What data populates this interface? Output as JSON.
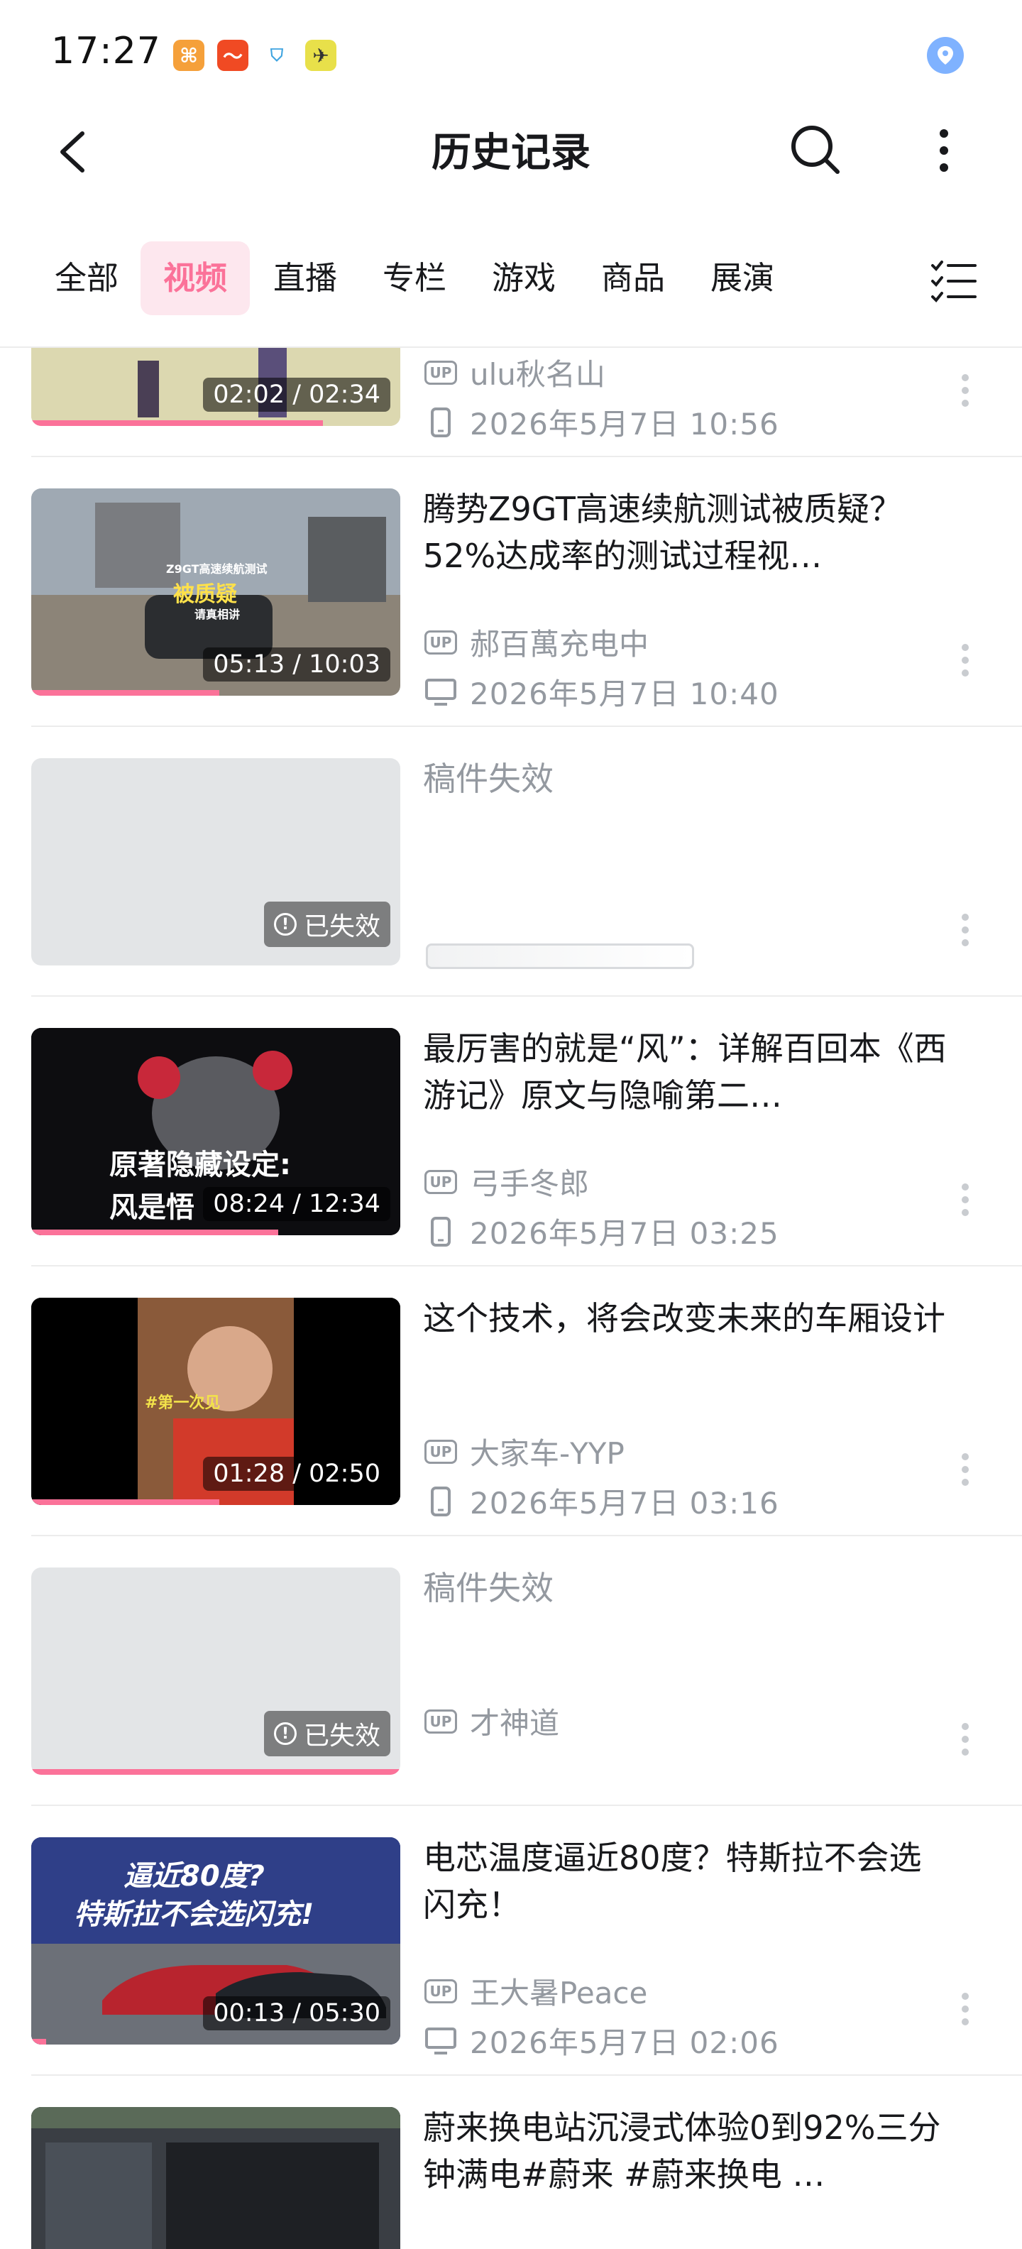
{
  "status_bar": {
    "time": "17:27"
  },
  "nav": {
    "title": "历史记录"
  },
  "tabs": [
    {
      "label": "全部"
    },
    {
      "label": "视频"
    },
    {
      "label": "直播"
    },
    {
      "label": "专栏"
    },
    {
      "label": "游戏"
    },
    {
      "label": "商品"
    },
    {
      "label": "展演"
    }
  ],
  "active_tab": "视频",
  "accent_color": "#fb7299",
  "items": [
    {
      "title": "",
      "up": "ulu秋名山",
      "time": "2026年5月7日 10:56",
      "device": "phone",
      "duration": "02:02 / 02:34",
      "progress": 0.79
    },
    {
      "title": "腾势Z9GT高速续航测试被质疑？52%达成率的测试过程视…",
      "up": "郝百萬充电中",
      "time": "2026年5月7日 10:40",
      "device": "pc",
      "duration": "05:13 / 10:03",
      "progress": 0.51,
      "thumb_text": [
        "Z9GT高速续航测试",
        "被质疑",
        "请真相讲"
      ]
    },
    {
      "title": "稿件失效",
      "expired_label": "已失效",
      "expired": true
    },
    {
      "title": "最厉害的就是“风”：详解百回本《西游记》原文与隐喻第二…",
      "up": "弓手冬郎",
      "time": "2026年5月7日 03:25",
      "device": "phone",
      "duration": "08:24 / 12:34",
      "progress": 0.67,
      "thumb_text": [
        "原著隐藏设定:",
        "风是悟"
      ]
    },
    {
      "title": "这个技术，将会改变未来的车厢设计",
      "up": "大家车-YYP",
      "time": "2026年5月7日 03:16",
      "device": "phone",
      "duration": "01:28 / 02:50",
      "progress": 0.51,
      "thumb_text": [
        "#第一次见"
      ]
    },
    {
      "title": "稿件失效",
      "up": "才神道",
      "expired_label": "已失效",
      "expired": true,
      "progress": 1.0
    },
    {
      "title": "电芯温度逼近80度？特斯拉不会选闪充！",
      "up": "王大暑Peace",
      "time": "2026年5月7日 02:06",
      "device": "pc",
      "duration": "00:13 / 05:30",
      "progress": 0.04,
      "thumb_text": [
        "逼近80度?",
        "特斯拉不会选闪充!"
      ]
    },
    {
      "title": "蔚来换电站沉浸式体验0到92%三分钟满电#蔚来 #蔚来换电 …",
      "up": "",
      "time": "",
      "device": "",
      "duration": "",
      "progress": 0
    }
  ]
}
